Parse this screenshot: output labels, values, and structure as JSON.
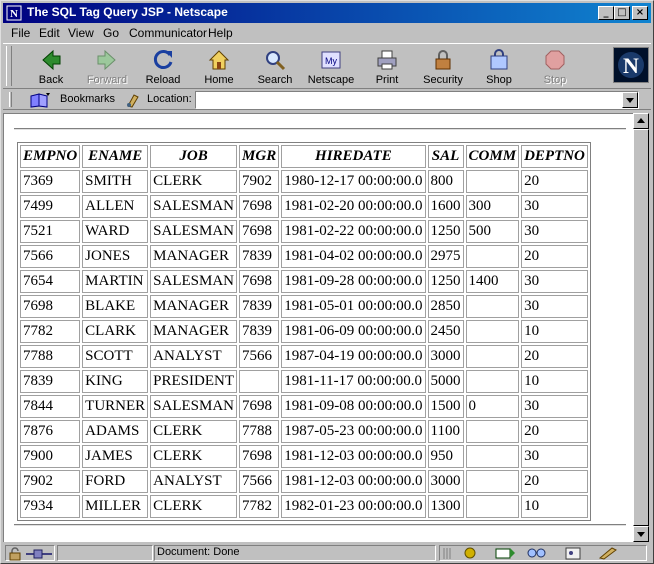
{
  "window": {
    "title": "The SQL Tag Query JSP - Netscape"
  },
  "menu": [
    "File",
    "Edit",
    "View",
    "Go",
    "Communicator",
    "Help"
  ],
  "toolbar": [
    {
      "label": "Back",
      "icon": "back-icon",
      "disabled": false
    },
    {
      "label": "Forward",
      "icon": "forward-icon",
      "disabled": true
    },
    {
      "label": "Reload",
      "icon": "reload-icon",
      "disabled": false
    },
    {
      "label": "Home",
      "icon": "home-icon",
      "disabled": false
    },
    {
      "label": "Search",
      "icon": "search-icon",
      "disabled": false
    },
    {
      "label": "Netscape",
      "icon": "netscape-icon",
      "disabled": false
    },
    {
      "label": "Print",
      "icon": "print-icon",
      "disabled": false
    },
    {
      "label": "Security",
      "icon": "security-icon",
      "disabled": false
    },
    {
      "label": "Shop",
      "icon": "shop-icon",
      "disabled": false
    },
    {
      "label": "Stop",
      "icon": "stop-icon",
      "disabled": true
    }
  ],
  "location_bar": {
    "bookmarks_label": "Bookmarks",
    "location_label": "Location:",
    "url": ""
  },
  "table": {
    "headers": [
      "EMPNO",
      "ENAME",
      "JOB",
      "MGR",
      "HIREDATE",
      "SAL",
      "COMM",
      "DEPTNO"
    ],
    "rows": [
      [
        "7369",
        "SMITH",
        "CLERK",
        "7902",
        "1980-12-17 00:00:00.0",
        "800",
        "",
        "20"
      ],
      [
        "7499",
        "ALLEN",
        "SALESMAN",
        "7698",
        "1981-02-20 00:00:00.0",
        "1600",
        "300",
        "30"
      ],
      [
        "7521",
        "WARD",
        "SALESMAN",
        "7698",
        "1981-02-22 00:00:00.0",
        "1250",
        "500",
        "30"
      ],
      [
        "7566",
        "JONES",
        "MANAGER",
        "7839",
        "1981-04-02 00:00:00.0",
        "2975",
        "",
        "20"
      ],
      [
        "7654",
        "MARTIN",
        "SALESMAN",
        "7698",
        "1981-09-28 00:00:00.0",
        "1250",
        "1400",
        "30"
      ],
      [
        "7698",
        "BLAKE",
        "MANAGER",
        "7839",
        "1981-05-01 00:00:00.0",
        "2850",
        "",
        "30"
      ],
      [
        "7782",
        "CLARK",
        "MANAGER",
        "7839",
        "1981-06-09 00:00:00.0",
        "2450",
        "",
        "10"
      ],
      [
        "7788",
        "SCOTT",
        "ANALYST",
        "7566",
        "1987-04-19 00:00:00.0",
        "3000",
        "",
        "20"
      ],
      [
        "7839",
        "KING",
        "PRESIDENT",
        "",
        "1981-11-17 00:00:00.0",
        "5000",
        "",
        "10"
      ],
      [
        "7844",
        "TURNER",
        "SALESMAN",
        "7698",
        "1981-09-08 00:00:00.0",
        "1500",
        "0",
        "30"
      ],
      [
        "7876",
        "ADAMS",
        "CLERK",
        "7788",
        "1987-05-23 00:00:00.0",
        "1100",
        "",
        "20"
      ],
      [
        "7900",
        "JAMES",
        "CLERK",
        "7698",
        "1981-12-03 00:00:00.0",
        "950",
        "",
        "30"
      ],
      [
        "7902",
        "FORD",
        "ANALYST",
        "7566",
        "1981-12-03 00:00:00.0",
        "3000",
        "",
        "20"
      ],
      [
        "7934",
        "MILLER",
        "CLERK",
        "7782",
        "1982-01-23 00:00:00.0",
        "1300",
        "",
        "10"
      ]
    ]
  },
  "status": {
    "text": "Document: Done"
  }
}
